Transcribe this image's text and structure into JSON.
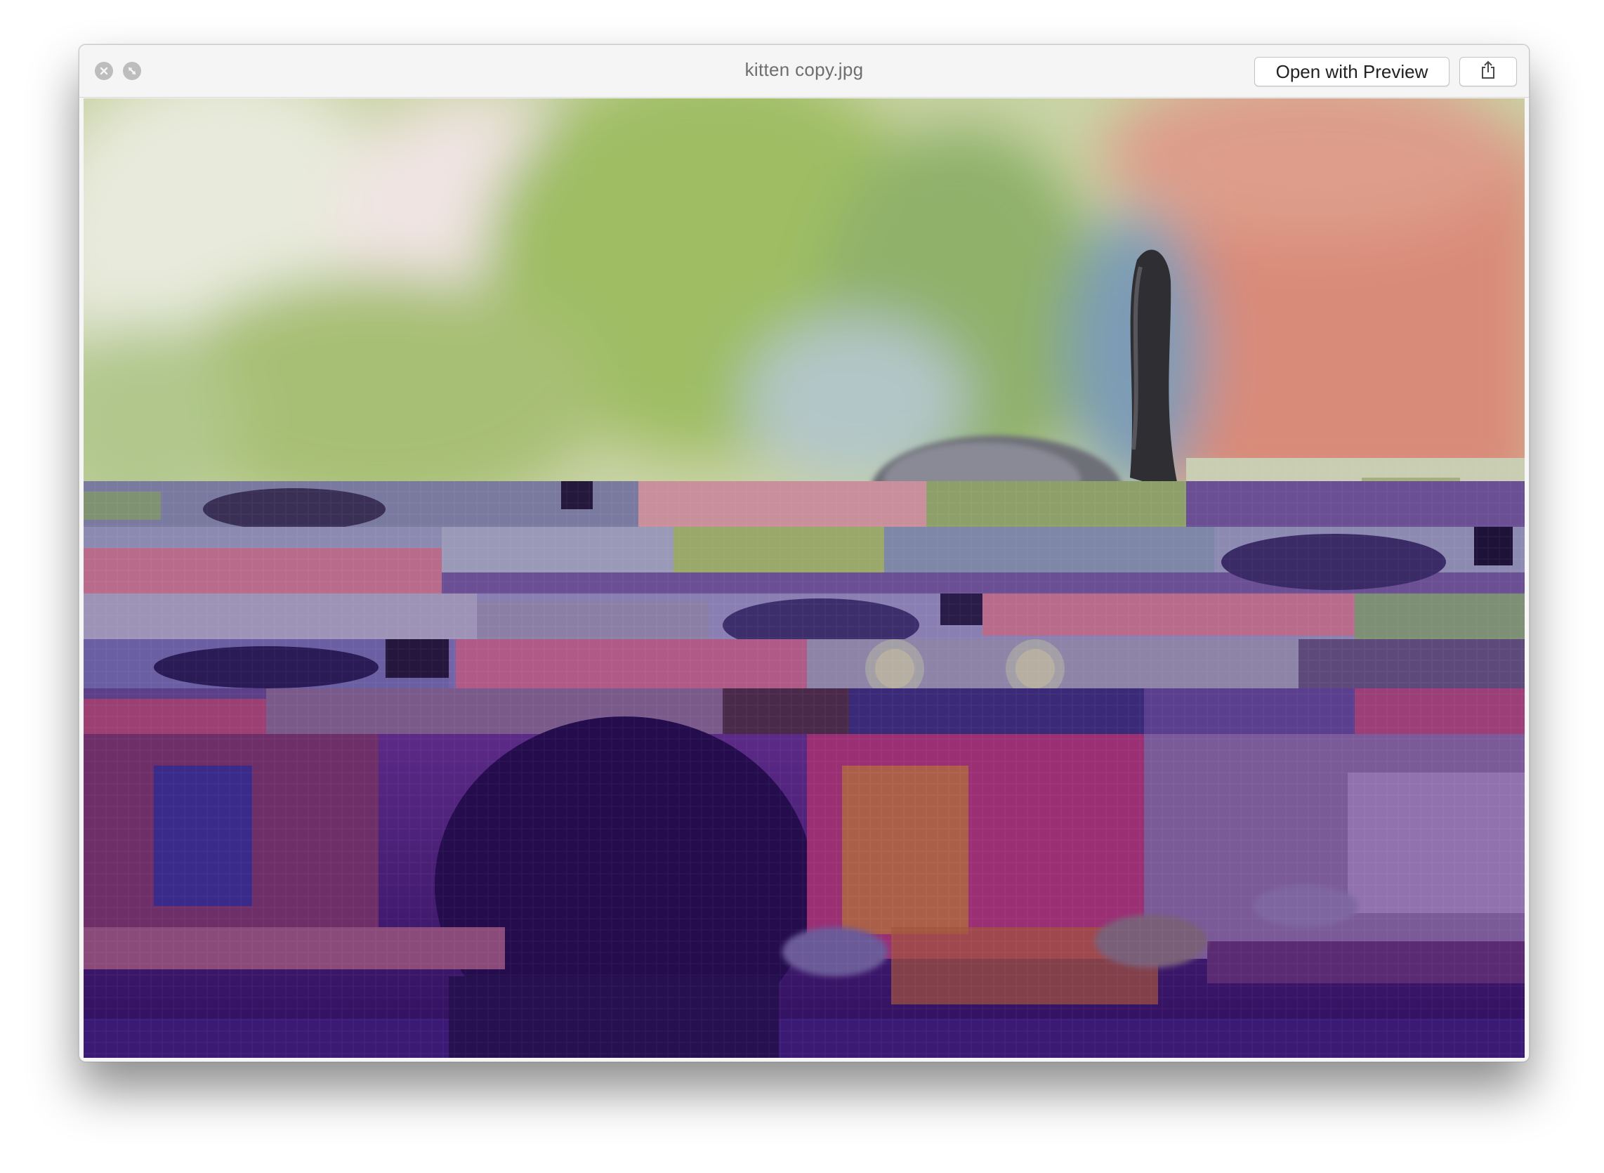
{
  "window": {
    "title": "kitten copy.jpg"
  },
  "toolbar": {
    "open_with_label": "Open with Preview"
  },
  "icons": {
    "close": "close-icon",
    "fullscreen": "fullscreen-icon",
    "share": "share-icon"
  },
  "image": {
    "description_name": "kitten-photo-glitched"
  },
  "colors": {
    "titlebar": "#f5f5f5",
    "glitch_purple": "#3a1466",
    "glitch_magenta": "#b84a8a",
    "bokeh_green": "#a9c77a",
    "brick_red": "#d89080"
  }
}
